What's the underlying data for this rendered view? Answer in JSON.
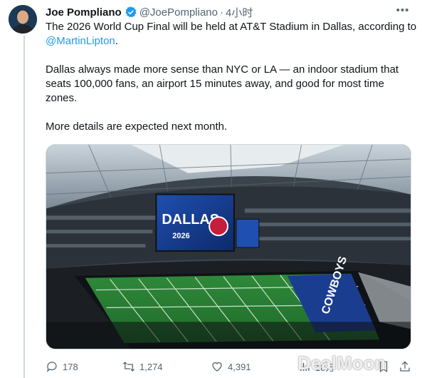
{
  "author": {
    "name": "Joe Pompliano",
    "handle": "@JoePompliano",
    "separator": "·",
    "time": "4小时"
  },
  "tweet": {
    "line1_text": "The 2026 World Cup Final will be held at AT&T Stadium in Dallas, according to ",
    "mention": "@MartinLipton",
    "line1_end": ".",
    "paragraph2": "Dallas always made more sense than NYC or LA — an indoor stadium that seats 100,000 fans, an airport 15 minutes away, and good for most time zones.",
    "paragraph3": "More details are expected next month."
  },
  "media": {
    "scoreboard_text": "DALLAS",
    "scoreboard_year": "2026",
    "endzone_text": "COWBOYS"
  },
  "actions": {
    "replies": "178",
    "reposts": "1,274",
    "likes": "4,391",
    "views": "18万"
  },
  "watermark": "DealMoon",
  "colors": {
    "accent": "#1d9bf0",
    "text": "#0f1419",
    "muted": "#536471"
  }
}
